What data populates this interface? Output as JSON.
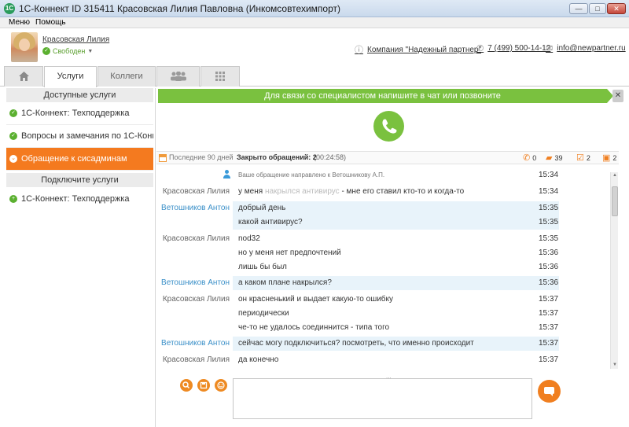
{
  "window": {
    "title": "1С-Коннект ID 315411 Красовская Лилия Павловна (Инкомсовтехимпорт)",
    "app_icon": "1С",
    "controls": {
      "minimize": "—",
      "maximize": "□",
      "close": "✕"
    }
  },
  "menu": {
    "items": [
      "Меню",
      "Помощь"
    ]
  },
  "profile": {
    "name": "Красовская Лилия",
    "status": "Свободен",
    "company": "Компания \"Надежный партнер\"",
    "phone": "7 (499) 500-14-12",
    "email": "info@newpartner.ru"
  },
  "tabs": {
    "home_icon": "home-icon",
    "services": "Услуги",
    "colleagues": "Коллеги",
    "groups_icon": "group-icon",
    "grid_icon": "grid-icon"
  },
  "sidebar": {
    "available_header": "Доступные услуги",
    "available": [
      {
        "label": "1С-Коннект: Техподдержка",
        "active": false
      },
      {
        "label": "Вопросы и замечания по 1С-Коннект",
        "active": false
      },
      {
        "label": "Обращение к сисадминам",
        "active": true
      }
    ],
    "connect_header": "Подключите услуги",
    "connect": [
      {
        "label": "1С-Коннект: Техподдержка"
      }
    ]
  },
  "banner": {
    "text": "Для связи со специалистом напишите в чат или позвоните",
    "close": "✕"
  },
  "stats": {
    "period": "Последние 90 дней",
    "closed": "Закрыто обращений: 2",
    "duration": "(00:24:58)",
    "calls": "0",
    "messages": "39",
    "tasks": "2",
    "files": "2"
  },
  "chat": {
    "messages": [
      {
        "sender": "",
        "text": "Ваше обращение направлено к Ветошникову А.П.",
        "time": "15:34",
        "system": true
      },
      {
        "sender": "Красовская Лилия",
        "text_a": "у меня ",
        "text_blur": "накрылся антивирус",
        "text_b": " - мне его ставил кто-то и когда-то",
        "time": "15:34"
      },
      {
        "sender": "Ветошников Антон",
        "text": "добрый день",
        "time": "15:35",
        "agent": true
      },
      {
        "sender": "",
        "text": "какой антивирус?",
        "time": "15:35",
        "agent": true
      },
      {
        "sender": "Красовская Лилия",
        "text": "nod32",
        "time": "15:35"
      },
      {
        "sender": "",
        "text": "но у меня нет предпочтений",
        "time": "15:36"
      },
      {
        "sender": "",
        "text": "лишь бы был",
        "time": "15:36"
      },
      {
        "sender": "Ветошников Антон",
        "text": "а каком плане накрылся?",
        "time": "15:36",
        "agent": true
      },
      {
        "sender": "Красовская Лилия",
        "text": "он красненький и выдает какую-то ошибку",
        "time": "15:37"
      },
      {
        "sender": "",
        "text": "периодически",
        "time": "15:37"
      },
      {
        "sender": "",
        "text": "че-то не удалось соединнится - типа того",
        "time": "15:37"
      },
      {
        "sender": "Ветошников Антон",
        "text": "сейчас могу подключиться? посмотреть, что именно происходит",
        "time": "15:37",
        "agent": true
      },
      {
        "sender": "Красовская Лилия",
        "text": "да конечно",
        "time": "15:37"
      }
    ]
  },
  "composer": {
    "grip": "...",
    "search_icon": "search-icon",
    "save_icon": "save-icon",
    "smile_icon": "smile-icon"
  },
  "colors": {
    "accent_orange": "#f47a1f",
    "accent_green": "#7ac13f",
    "agent_blue": "#3a8fc8"
  }
}
